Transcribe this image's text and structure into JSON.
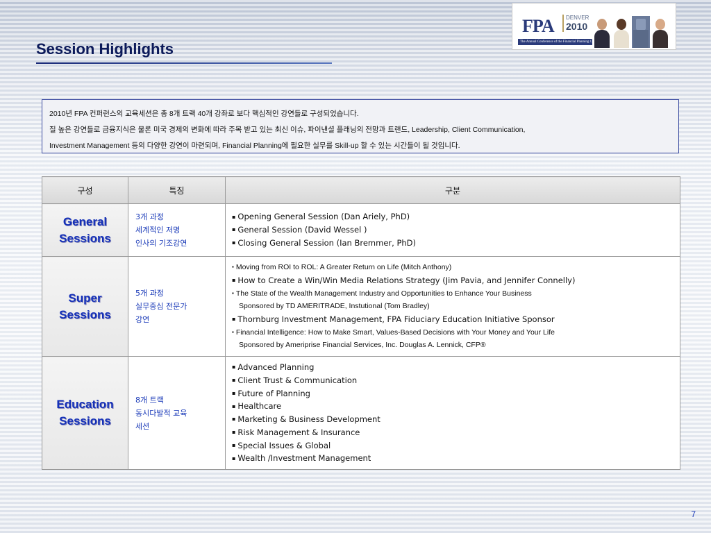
{
  "title": "Session Highlights",
  "logo": {
    "brand": "FPA",
    "event_city": "DENVER",
    "event_year": "2010",
    "tagline": "The Annual Conference of the Financial Planning Community"
  },
  "intro": {
    "lines": [
      "2010년 FPA 컨퍼런스의 교육세션은 총 8개 트랙 40개 강좌로 보다 핵심적인 강연들로 구성되었습니다.",
      "질 높은 강연들로 금융지식은 물론 미국 경제의 변화에 따라 주목 받고 있는 최신 이슈, 파이낸셜 플래닝의 전망과 트랜드, Leadership, Client Communication,",
      "Investment Management 등의 다양한 강연이 마련되며, Financial Planning에 필요한 실무를 Skill-up 할 수 있는 시간들이 될 것입니다."
    ]
  },
  "table": {
    "headers": [
      "구성",
      "특징",
      "구분"
    ],
    "rows": [
      {
        "category": [
          "General",
          "Sessions"
        ],
        "features": [
          "3개 과정",
          "세계적인 저명",
          "인사의 기조강연"
        ],
        "items": [
          "Opening General Session (Dan Ariely, PhD)",
          "General Session (David Wessel )",
          "Closing General Session (Ian Bremmer, PhD)"
        ]
      },
      {
        "category": [
          "Super",
          "Sessions"
        ],
        "features": [
          "5개 과정",
          "실무중심 전문가",
          "강연"
        ],
        "items": [
          "Moving from ROI to ROL: A Greater Return on Life  (Mitch Anthony)",
          "How to Create a Win/Win Media Relations Strategy (Jim Pavia, and Jennifer Connelly)",
          "The State of the Wealth Management Industry and Opportunities to Enhance Your Business",
          "Sponsored by TD AMERITRADE, Instutional (Tom Bradley)",
          "Thornburg Investment Management, FPA Fiduciary Education Initiative Sponsor",
          "Financial Intelligence: How to Make Smart, Values-Based Decisions with Your Money and Your Life",
          "Sponsored by Ameriprise Financial Services, Inc. Douglas A. Lennick, CFP®"
        ]
      },
      {
        "category": [
          "Education",
          "Sessions"
        ],
        "features": [
          "8개 트랙",
          "동시다발적 교육",
          "세션"
        ],
        "items": [
          "Advanced Planning",
          "Client Trust & Communication",
          "Future of Planning",
          "Healthcare",
          "Marketing & Business Development",
          "Risk Management & Insurance",
          "Special Issues & Global",
          "Wealth /Investment Management"
        ]
      }
    ]
  },
  "page_number": "7",
  "colors": {
    "title": "#0c1a5a",
    "category_text": "#1430b8",
    "feature_text": "#1a3ab8",
    "intro_border": "#3a4aa0"
  }
}
